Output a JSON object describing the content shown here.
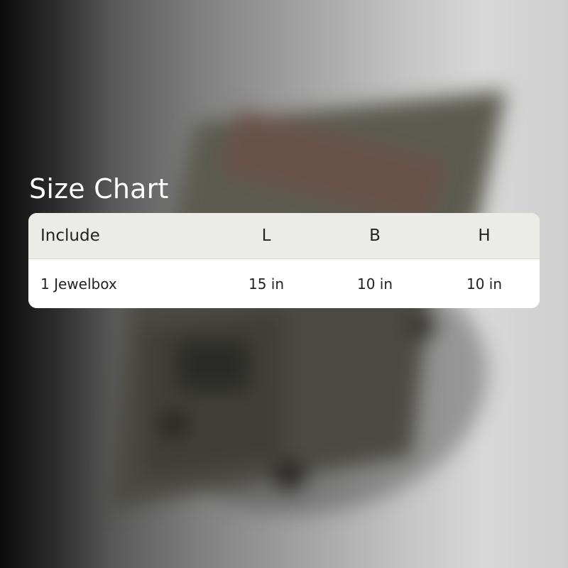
{
  "title": "Size Chart",
  "table": {
    "headers": [
      "Include",
      "L",
      "B",
      "H"
    ],
    "rows": [
      [
        "1 Jewelbox",
        "15 in",
        "10 in",
        "10 in"
      ]
    ]
  },
  "colors": {
    "header_bg": "#ebebe7",
    "body_bg": "#ffffff",
    "title_text": "#ffffff",
    "table_text": "#222222"
  }
}
